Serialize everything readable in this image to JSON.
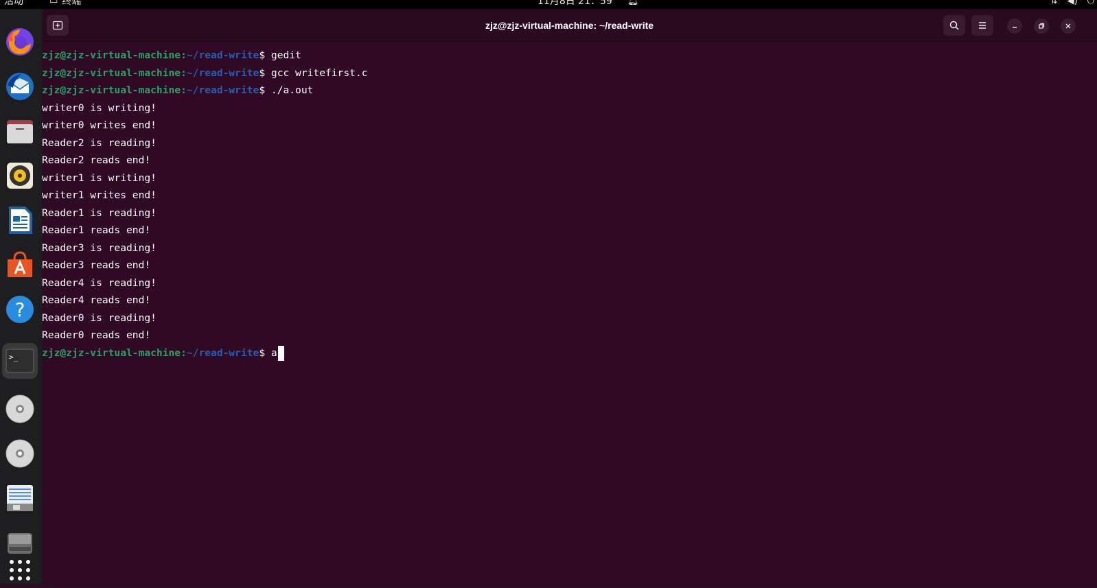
{
  "topbar": {
    "activities": "活动",
    "app_name": "终端",
    "datetime": "11月8日  21：59",
    "icons": [
      "terminal-icon",
      "bell-icon",
      "network-icon",
      "volume-icon",
      "power-icon"
    ]
  },
  "dock": {
    "items": [
      {
        "name": "firefox",
        "icon": "firefox-icon"
      },
      {
        "name": "thunderbird",
        "icon": "thunderbird-icon"
      },
      {
        "name": "files",
        "icon": "files-icon"
      },
      {
        "name": "rhythmbox",
        "icon": "rhythmbox-icon"
      },
      {
        "name": "writer",
        "icon": "writer-icon"
      },
      {
        "name": "app-center",
        "icon": "app-center-icon"
      },
      {
        "name": "help",
        "icon": "help-icon"
      },
      {
        "name": "terminal",
        "icon": "terminal-icon"
      },
      {
        "name": "disc-1",
        "icon": "disc-icon"
      },
      {
        "name": "disc-2",
        "icon": "disc-icon"
      },
      {
        "name": "text-editor",
        "icon": "document-icon"
      },
      {
        "name": "drive",
        "icon": "drive-icon"
      },
      {
        "name": "show-apps",
        "icon": "apps-grid-icon"
      }
    ],
    "colors": {
      "background": "#1e1d1f",
      "active": "#3a393c"
    }
  },
  "window": {
    "title": "zjz@zjz-virtual-machine: ~/read-write",
    "buttons": [
      "new-tab-icon",
      "search-icon",
      "hamburger-menu-icon",
      "minimize-icon",
      "restore-icon",
      "close-icon"
    ],
    "colors": {
      "background": "#300a24",
      "user": "#26a269",
      "path": "#2a5db0",
      "text": "#ffffff"
    }
  },
  "terminal": {
    "prompt": {
      "user": "zjz@zjz-virtual-machine",
      "sep": ":",
      "path": "~/read-write",
      "symbol": "$"
    },
    "lines": [
      {
        "prompt": true,
        "text": " gedit"
      },
      {
        "prompt": true,
        "text": " gcc writefirst.c"
      },
      {
        "prompt": true,
        "text": " ./a.out"
      },
      {
        "prompt": false,
        "text": "writer0 is writing!"
      },
      {
        "prompt": false,
        "text": "writer0 writes end!"
      },
      {
        "prompt": false,
        "text": "Reader2 is reading!"
      },
      {
        "prompt": false,
        "text": "Reader2 reads end!"
      },
      {
        "prompt": false,
        "text": "writer1 is writing!"
      },
      {
        "prompt": false,
        "text": "writer1 writes end!"
      },
      {
        "prompt": false,
        "text": "Reader1 is reading!"
      },
      {
        "prompt": false,
        "text": "Reader1 reads end!"
      },
      {
        "prompt": false,
        "text": "Reader3 is reading!"
      },
      {
        "prompt": false,
        "text": "Reader3 reads end!"
      },
      {
        "prompt": false,
        "text": "Reader4 is reading!"
      },
      {
        "prompt": false,
        "text": "Reader4 reads end!"
      },
      {
        "prompt": false,
        "text": "Reader0 is reading!"
      },
      {
        "prompt": false,
        "text": "Reader0 reads end!"
      },
      {
        "prompt": true,
        "text": " a",
        "cursor": true
      }
    ]
  }
}
